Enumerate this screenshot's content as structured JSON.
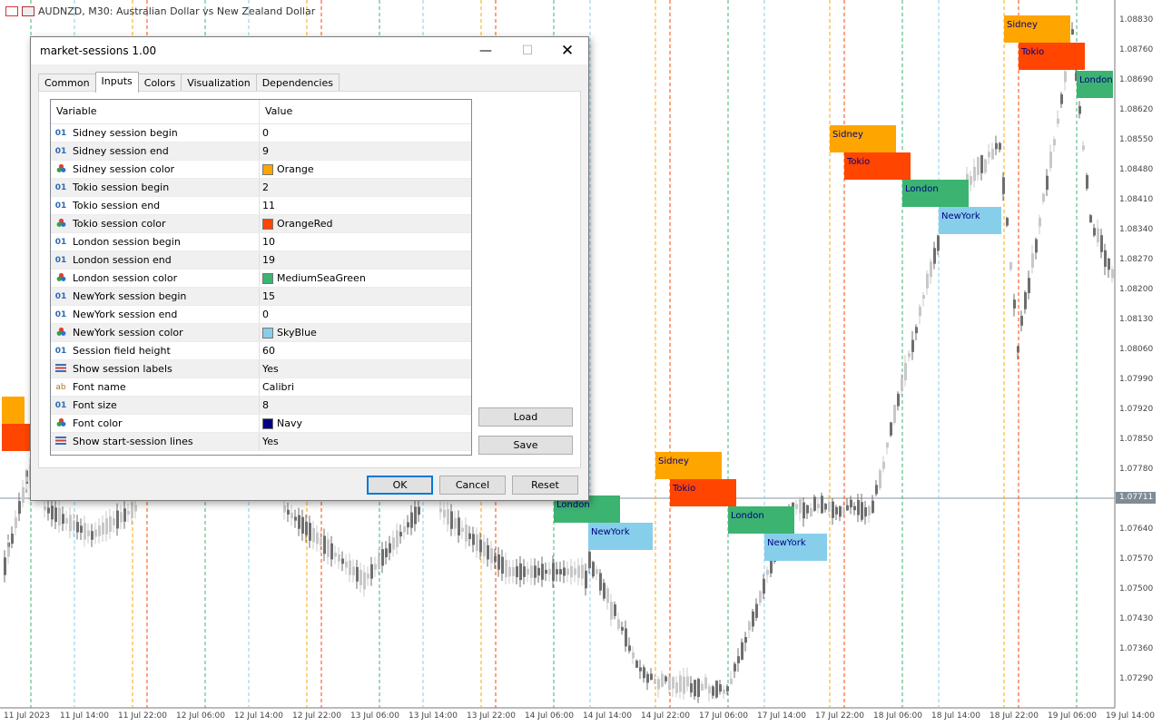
{
  "chart": {
    "symbol_title": "AUDNZD, M30:  Australian Dollar vs New Zealand Dollar",
    "price_labels": [
      "1.08830",
      "1.08760",
      "1.08690",
      "1.08620",
      "1.08550",
      "1.08480",
      "1.08410",
      "1.08340",
      "1.08270",
      "1.08200",
      "1.08130",
      "1.08060",
      "1.07990",
      "1.07920",
      "1.07850",
      "1.07780",
      "1.07640",
      "1.07570",
      "1.07500",
      "1.07430",
      "1.07360",
      "1.07290"
    ],
    "current_price": "1.07711",
    "time_labels": [
      "11 Jul 2023",
      "11 Jul 14:00",
      "11 Jul 22:00",
      "12 Jul 06:00",
      "12 Jul 14:00",
      "12 Jul 22:00",
      "13 Jul 06:00",
      "13 Jul 14:00",
      "13 Jul 22:00",
      "14 Jul 06:00",
      "14 Jul 14:00",
      "14 Jul 22:00",
      "17 Jul 06:00",
      "17 Jul 14:00",
      "17 Jul 22:00",
      "18 Jul 06:00",
      "18 Jul 14:00",
      "18 Jul 22:00",
      "19 Jul 06:00",
      "19 Jul 14:00"
    ],
    "session_names": {
      "sidney": "Sidney",
      "tokio": "Tokio",
      "london": "London",
      "newyork": "NewYork"
    },
    "colors": {
      "sidney": "#FFA500",
      "tokio": "#FF4500",
      "london": "#3CB371",
      "newyork": "#87CEEB",
      "label": "#000080"
    }
  },
  "dialog": {
    "title": "market-sessions 1.00",
    "tabs": [
      "Common",
      "Inputs",
      "Colors",
      "Visualization",
      "Dependencies"
    ],
    "active_tab": "Inputs",
    "columns": {
      "variable": "Variable",
      "value": "Value"
    },
    "rows": [
      {
        "icon": "01",
        "variable": "Sidney session begin",
        "value": "0"
      },
      {
        "icon": "01",
        "variable": "Sidney session end",
        "value": "9"
      },
      {
        "icon": "color",
        "variable": "Sidney session color",
        "value": "Orange",
        "swatch": "#FFA500"
      },
      {
        "icon": "01",
        "variable": "Tokio session begin",
        "value": "2"
      },
      {
        "icon": "01",
        "variable": "Tokio session end",
        "value": "11"
      },
      {
        "icon": "color",
        "variable": "Tokio session color",
        "value": "OrangeRed",
        "swatch": "#FF4500"
      },
      {
        "icon": "01",
        "variable": "London session begin",
        "value": "10"
      },
      {
        "icon": "01",
        "variable": "London session end",
        "value": "19"
      },
      {
        "icon": "color",
        "variable": "London session color",
        "value": "MediumSeaGreen",
        "swatch": "#3CB371"
      },
      {
        "icon": "01",
        "variable": "NewYork session begin",
        "value": "15"
      },
      {
        "icon": "01",
        "variable": "NewYork session end",
        "value": "0"
      },
      {
        "icon": "color",
        "variable": "NewYork session color",
        "value": "SkyBlue",
        "swatch": "#87CEEB"
      },
      {
        "icon": "01",
        "variable": "Session field height",
        "value": "60"
      },
      {
        "icon": "bool",
        "variable": "Show session labels",
        "value": "Yes"
      },
      {
        "icon": "ab",
        "variable": "Font name",
        "value": "Calibri"
      },
      {
        "icon": "01",
        "variable": "Font size",
        "value": "8"
      },
      {
        "icon": "color",
        "variable": "Font color",
        "value": "Navy",
        "swatch": "#000080"
      },
      {
        "icon": "bool",
        "variable": "Show start-session lines",
        "value": "Yes"
      }
    ],
    "buttons": {
      "load": "Load",
      "save": "Save",
      "ok": "OK",
      "cancel": "Cancel",
      "reset": "Reset"
    }
  }
}
